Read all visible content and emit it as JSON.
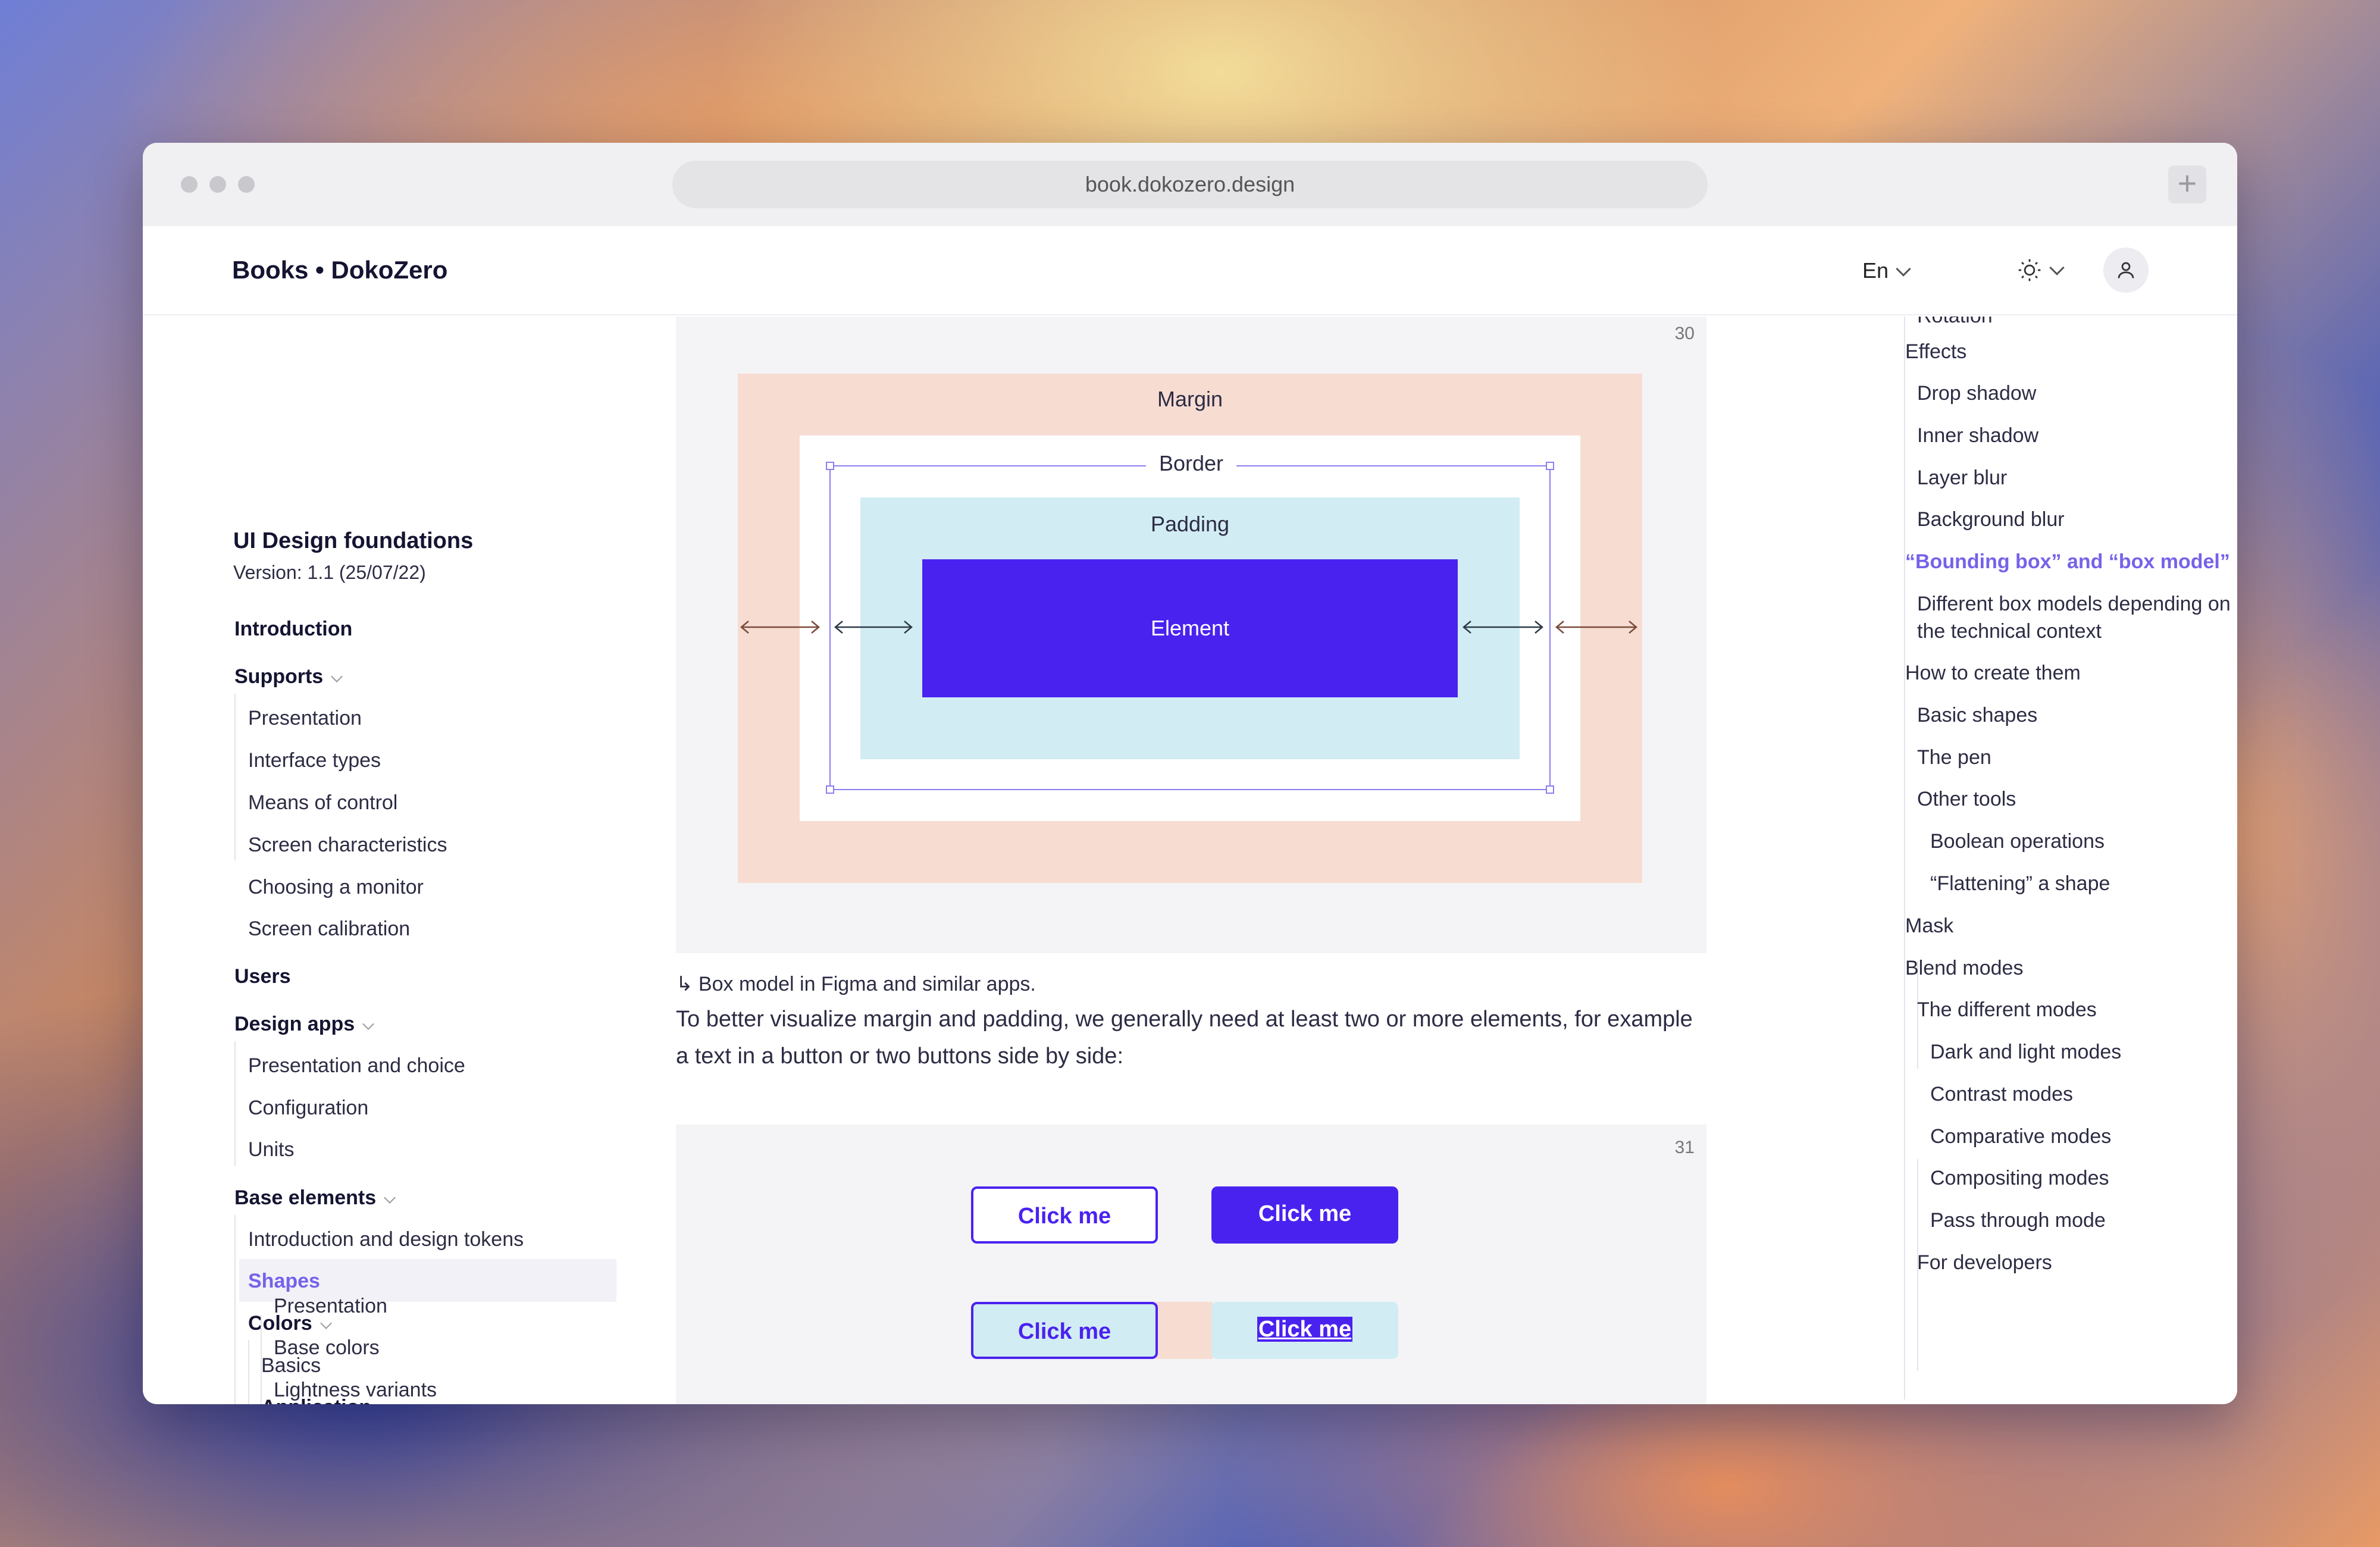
{
  "browser": {
    "url": "book.dokozero.design",
    "new_tab": "+"
  },
  "header": {
    "brand": "Books • DokoZero",
    "language": "En"
  },
  "book": {
    "title": "UI Design foundations",
    "version": "Version: 1.1 (25/07/22)"
  },
  "sidebar": {
    "introduction": "Introduction",
    "supports": "Supports",
    "supports_items": [
      "Presentation",
      "Interface types",
      "Means of control",
      "Screen characteristics",
      "Choosing a monitor",
      "Screen calibration"
    ],
    "users": "Users",
    "design_apps": "Design apps",
    "design_apps_items": [
      "Presentation and choice",
      "Configuration",
      "Units"
    ],
    "base_elements": "Base elements",
    "base_elements_items": [
      "Introduction and design tokens",
      "Shapes"
    ],
    "colors": "Colors",
    "colors_basics": "Basics",
    "application": "Application",
    "application_items": [
      "Presentation",
      "Base colors",
      "Lightness variants"
    ]
  },
  "figure1": {
    "number": "30",
    "margin_label": "Margin",
    "border_label": "Border",
    "padding_label": "Padding",
    "element_label": "Element"
  },
  "caption": "↳ Box model in Figma and similar apps.",
  "paragraph": "To better visualize margin and padding, we generally need at least two or more elements, for example a text in a button or two buttons side by side:",
  "figure2": {
    "number": "31",
    "buttons": [
      "Click me",
      "Click me",
      "Click me",
      "Click me"
    ]
  },
  "toc": {
    "items": [
      {
        "label": "Rotation",
        "level": 1
      },
      {
        "label": "Effects",
        "level": 0
      },
      {
        "label": "Drop shadow",
        "level": 1
      },
      {
        "label": "Inner shadow",
        "level": 1
      },
      {
        "label": "Layer blur",
        "level": 1
      },
      {
        "label": "Background blur",
        "level": 1
      },
      {
        "label": "“Bounding box” and “box model”",
        "level": 0,
        "active": true
      },
      {
        "label": "Different box models depending on",
        "level": 1
      },
      {
        "label": "the technical context",
        "level": 1
      },
      {
        "label": "How to create them",
        "level": 0
      },
      {
        "label": "Basic shapes",
        "level": 1
      },
      {
        "label": "The pen",
        "level": 1
      },
      {
        "label": "Other tools",
        "level": 1
      },
      {
        "label": "Boolean operations",
        "level": 2
      },
      {
        "label": "“Flattening” a shape",
        "level": 2
      },
      {
        "label": "Mask",
        "level": 0
      },
      {
        "label": "Blend modes",
        "level": 0
      },
      {
        "label": "The different modes",
        "level": 1
      },
      {
        "label": "Dark and light modes",
        "level": 2
      },
      {
        "label": "Contrast modes",
        "level": 2
      },
      {
        "label": "Comparative modes",
        "level": 2
      },
      {
        "label": "Compositing modes",
        "level": 2
      },
      {
        "label": "Pass through mode",
        "level": 2
      },
      {
        "label": "For developers",
        "level": 1
      }
    ]
  },
  "colors": {
    "accent": "#4a22f0",
    "accent_text": "#7562ea",
    "margin_fill": "#f7dcd2",
    "padding_fill": "#d2ecf4",
    "figure_bg": "#f4f4f6"
  },
  "icons": {
    "theme": "sun-icon",
    "user": "user-icon",
    "caption_arrow": "return-arrow-icon"
  }
}
